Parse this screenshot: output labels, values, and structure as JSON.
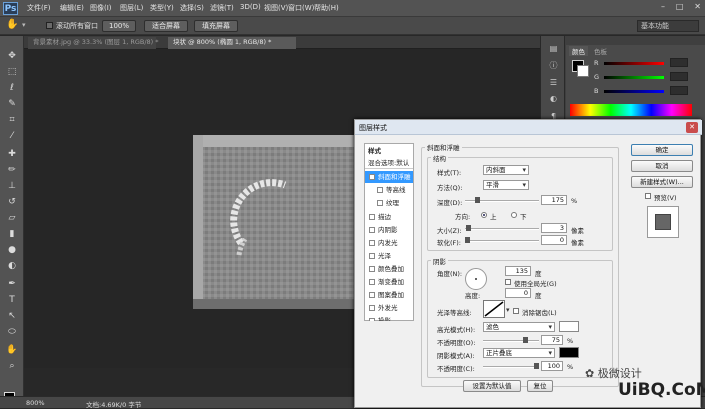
{
  "app": {
    "logo": "Ps"
  },
  "menu": [
    "文件(F)",
    "编辑(E)",
    "图像(I)",
    "图层(L)",
    "类型(Y)",
    "选择(S)",
    "滤镜(T)",
    "3D(D)",
    "视图(V)",
    "窗口(W)",
    "帮助(H)"
  ],
  "options": {
    "scroll_all": "滚动所有窗口",
    "zoom100": "100%",
    "fit_screen": "适合屏幕",
    "fill_screen": "填充屏幕",
    "workspace": "基本功能"
  },
  "tabs": [
    "背景素材.jpg @ 33.3% (图层 1, RGB/8) *",
    "块状 @ 800% (椭圆 1, RGB/8) *"
  ],
  "panels": {
    "color": "颜色",
    "swatches": "色板",
    "r": "R",
    "g": "G",
    "b": "B"
  },
  "status": {
    "zoom": "800%",
    "doc": "文档:4.69K/0 字节"
  },
  "dialog": {
    "title": "图层样式",
    "styles_header": "样式",
    "blend_opts": "混合选项:默认",
    "styles": [
      "斜面和浮雕",
      "等高线",
      "纹理",
      "描边",
      "内阴影",
      "内发光",
      "光泽",
      "颜色叠加",
      "渐变叠加",
      "图案叠加",
      "外发光",
      "投影"
    ],
    "bevel_title": "斜面和浮雕",
    "struct_title": "结构",
    "style_label": "样式(T):",
    "style_val": "内斜面",
    "method_label": "方法(Q):",
    "method_val": "平滑",
    "depth_label": "深度(D):",
    "depth_val": "175",
    "pct": "%",
    "dir_label": "方向:",
    "dir_up": "上",
    "dir_down": "下",
    "size_label": "大小(Z):",
    "size_val": "3",
    "px": "像素",
    "soften_label": "软化(F):",
    "soften_val": "0",
    "shading_title": "阴影",
    "angle_label": "角度(N):",
    "angle_val": "135",
    "deg": "度",
    "global_light": "使用全局光(G)",
    "altitude_label": "高度:",
    "altitude_val": "0",
    "gloss_label": "光泽等高线:",
    "antialias": "消除锯齿(L)",
    "hl_mode_label": "高光模式(H):",
    "hl_mode_val": "滤色",
    "hl_op_label": "不透明度(O):",
    "hl_op_val": "75",
    "sh_mode_label": "阴影模式(A):",
    "sh_mode_val": "正片叠底",
    "sh_op_label": "不透明度(C):",
    "sh_op_val": "100",
    "set_default": "设置为默认值",
    "reset_default": "复位",
    "ok": "确定",
    "cancel": "取消",
    "new_style": "新建样式(W)...",
    "preview": "预览(V)"
  },
  "watermark": "✿ 极微设计",
  "site": "UiBQ.CoM"
}
